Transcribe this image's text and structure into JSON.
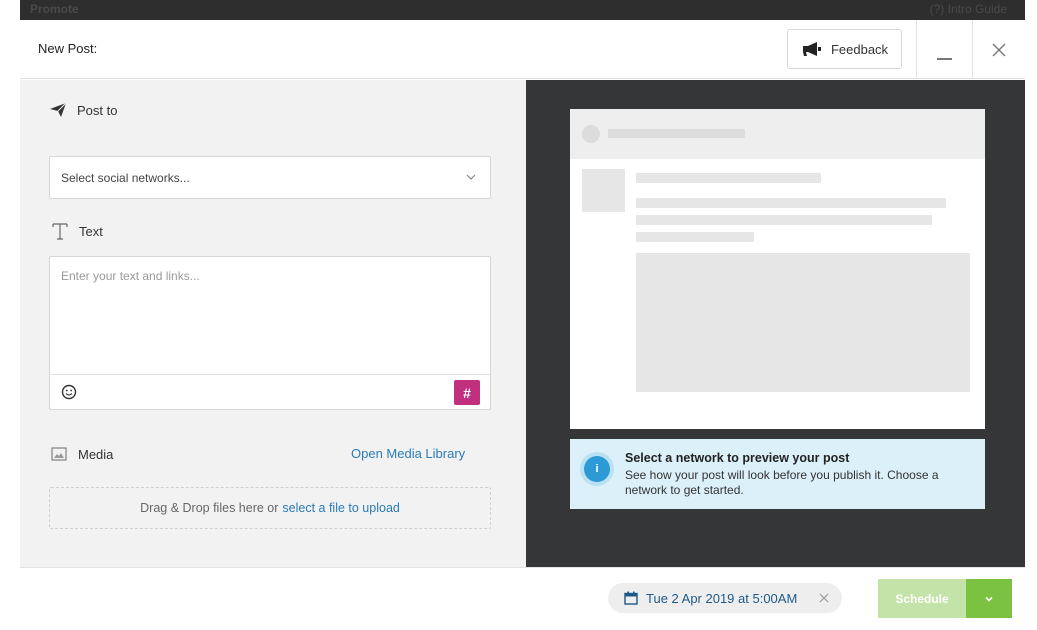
{
  "backdrop": {
    "left_text": "Promote",
    "right_text": "(?) Intro Guide"
  },
  "header": {
    "title": "New Post:",
    "feedback_label": "Feedback"
  },
  "post_to": {
    "label": "Post to",
    "select_text": "Select social networks..."
  },
  "text": {
    "label": "Text",
    "placeholder": "Enter your text and links...",
    "hashtag": "#"
  },
  "media": {
    "label": "Media",
    "library_link": "Open Media Library",
    "drop_text": "Drag & Drop files here or",
    "drop_link": "select a file to upload"
  },
  "preview": {
    "info_title": "Select a network to preview your post",
    "info_desc": "See how your post will look before you publish it. Choose a network to get started.",
    "info_icon": "i"
  },
  "footer": {
    "date": "Tue 2 Apr 2019 at 5:00AM",
    "schedule_label": "Schedule"
  },
  "colors": {
    "accent_green": "#7cc242",
    "hashtag_magenta": "#c1307f",
    "link_blue": "#2b7bb9",
    "preview_bg": "#343638",
    "info_bg": "#dbf0f8"
  }
}
